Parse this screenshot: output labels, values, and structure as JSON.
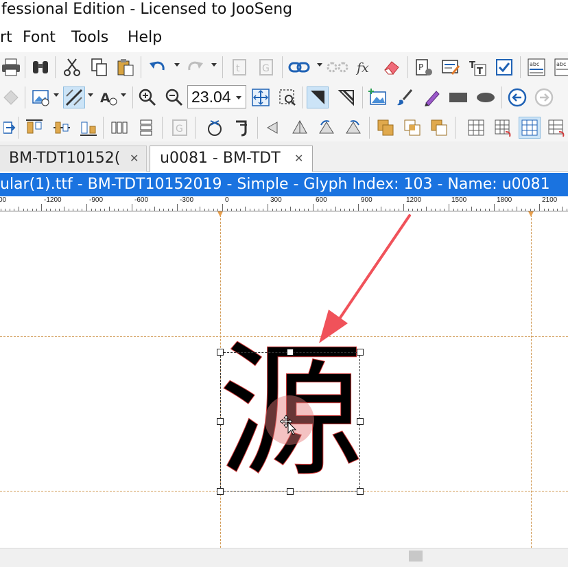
{
  "window": {
    "title": "fessional Edition - Licensed to JooSeng"
  },
  "menu": {
    "items": [
      "rt",
      "Font",
      "Tools",
      "Help"
    ]
  },
  "toolbar": {
    "zoom_value": "23.04"
  },
  "tabs": [
    {
      "label": "BM-TDT10152(",
      "active": false
    },
    {
      "label": "u0081 - BM-TDT",
      "active": true
    }
  ],
  "glyph_window": {
    "title": "ular(1).ttf - BM-TDT10152019 - Simple - Glyph Index: 103 - Name: u0081"
  },
  "ruler": {
    "labels": [
      "00",
      "-1200",
      "-900",
      "-600",
      "-300",
      "0",
      "300",
      "600",
      "900",
      "1200",
      "1500",
      "1800",
      "2100"
    ]
  },
  "glyph": {
    "character": "源"
  },
  "colors": {
    "accent_bar": "#1a73e0",
    "guide": "#d19a55",
    "arrow": "#f0525a",
    "glyph_outline": "#d23a3a"
  }
}
